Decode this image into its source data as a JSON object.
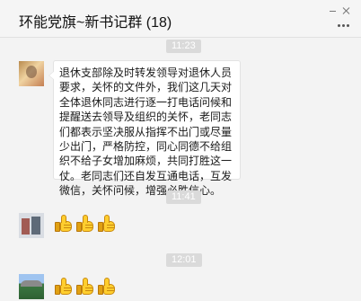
{
  "window": {
    "title": "环能党旗~新书记群 (18)",
    "minimize_icon": "minimize-icon",
    "close_icon": "close-icon",
    "more_icon": "more-options-icon"
  },
  "messages": [
    {
      "type": "time",
      "text": "11:23"
    },
    {
      "type": "text",
      "sender_avatar": "avatar-icon",
      "text": "退休支部除及时转发领导对退休人员要求，关怀的文件外，我们这几天对全体退休同志进行逐一打电话问候和提醒送去领导及组织的关怀，老同志们都表示坚决服从指挥不出门或尽量少出门，严格防控，同心同德不给组织不给子女增加麻烦，共同打胜这一仗。老同志们还自发互通电话，互发微信，关怀问候，增强必胜信心。"
    },
    {
      "type": "time",
      "text": "11:41"
    },
    {
      "type": "emoji",
      "sender_avatar": "avatar-icon",
      "emojis": [
        "thumbs-up-icon",
        "thumbs-up-icon",
        "thumbs-up-icon"
      ]
    },
    {
      "type": "time",
      "text": "12:01"
    },
    {
      "type": "emoji",
      "sender_avatar": "avatar-icon",
      "emojis": [
        "thumbs-up-icon",
        "thumbs-up-icon",
        "thumbs-up-icon"
      ]
    }
  ],
  "colors": {
    "background": "#f3f3f3",
    "bubble": "#ffffff",
    "time_badge": "#dadada",
    "thumb": "#ffce2e"
  }
}
